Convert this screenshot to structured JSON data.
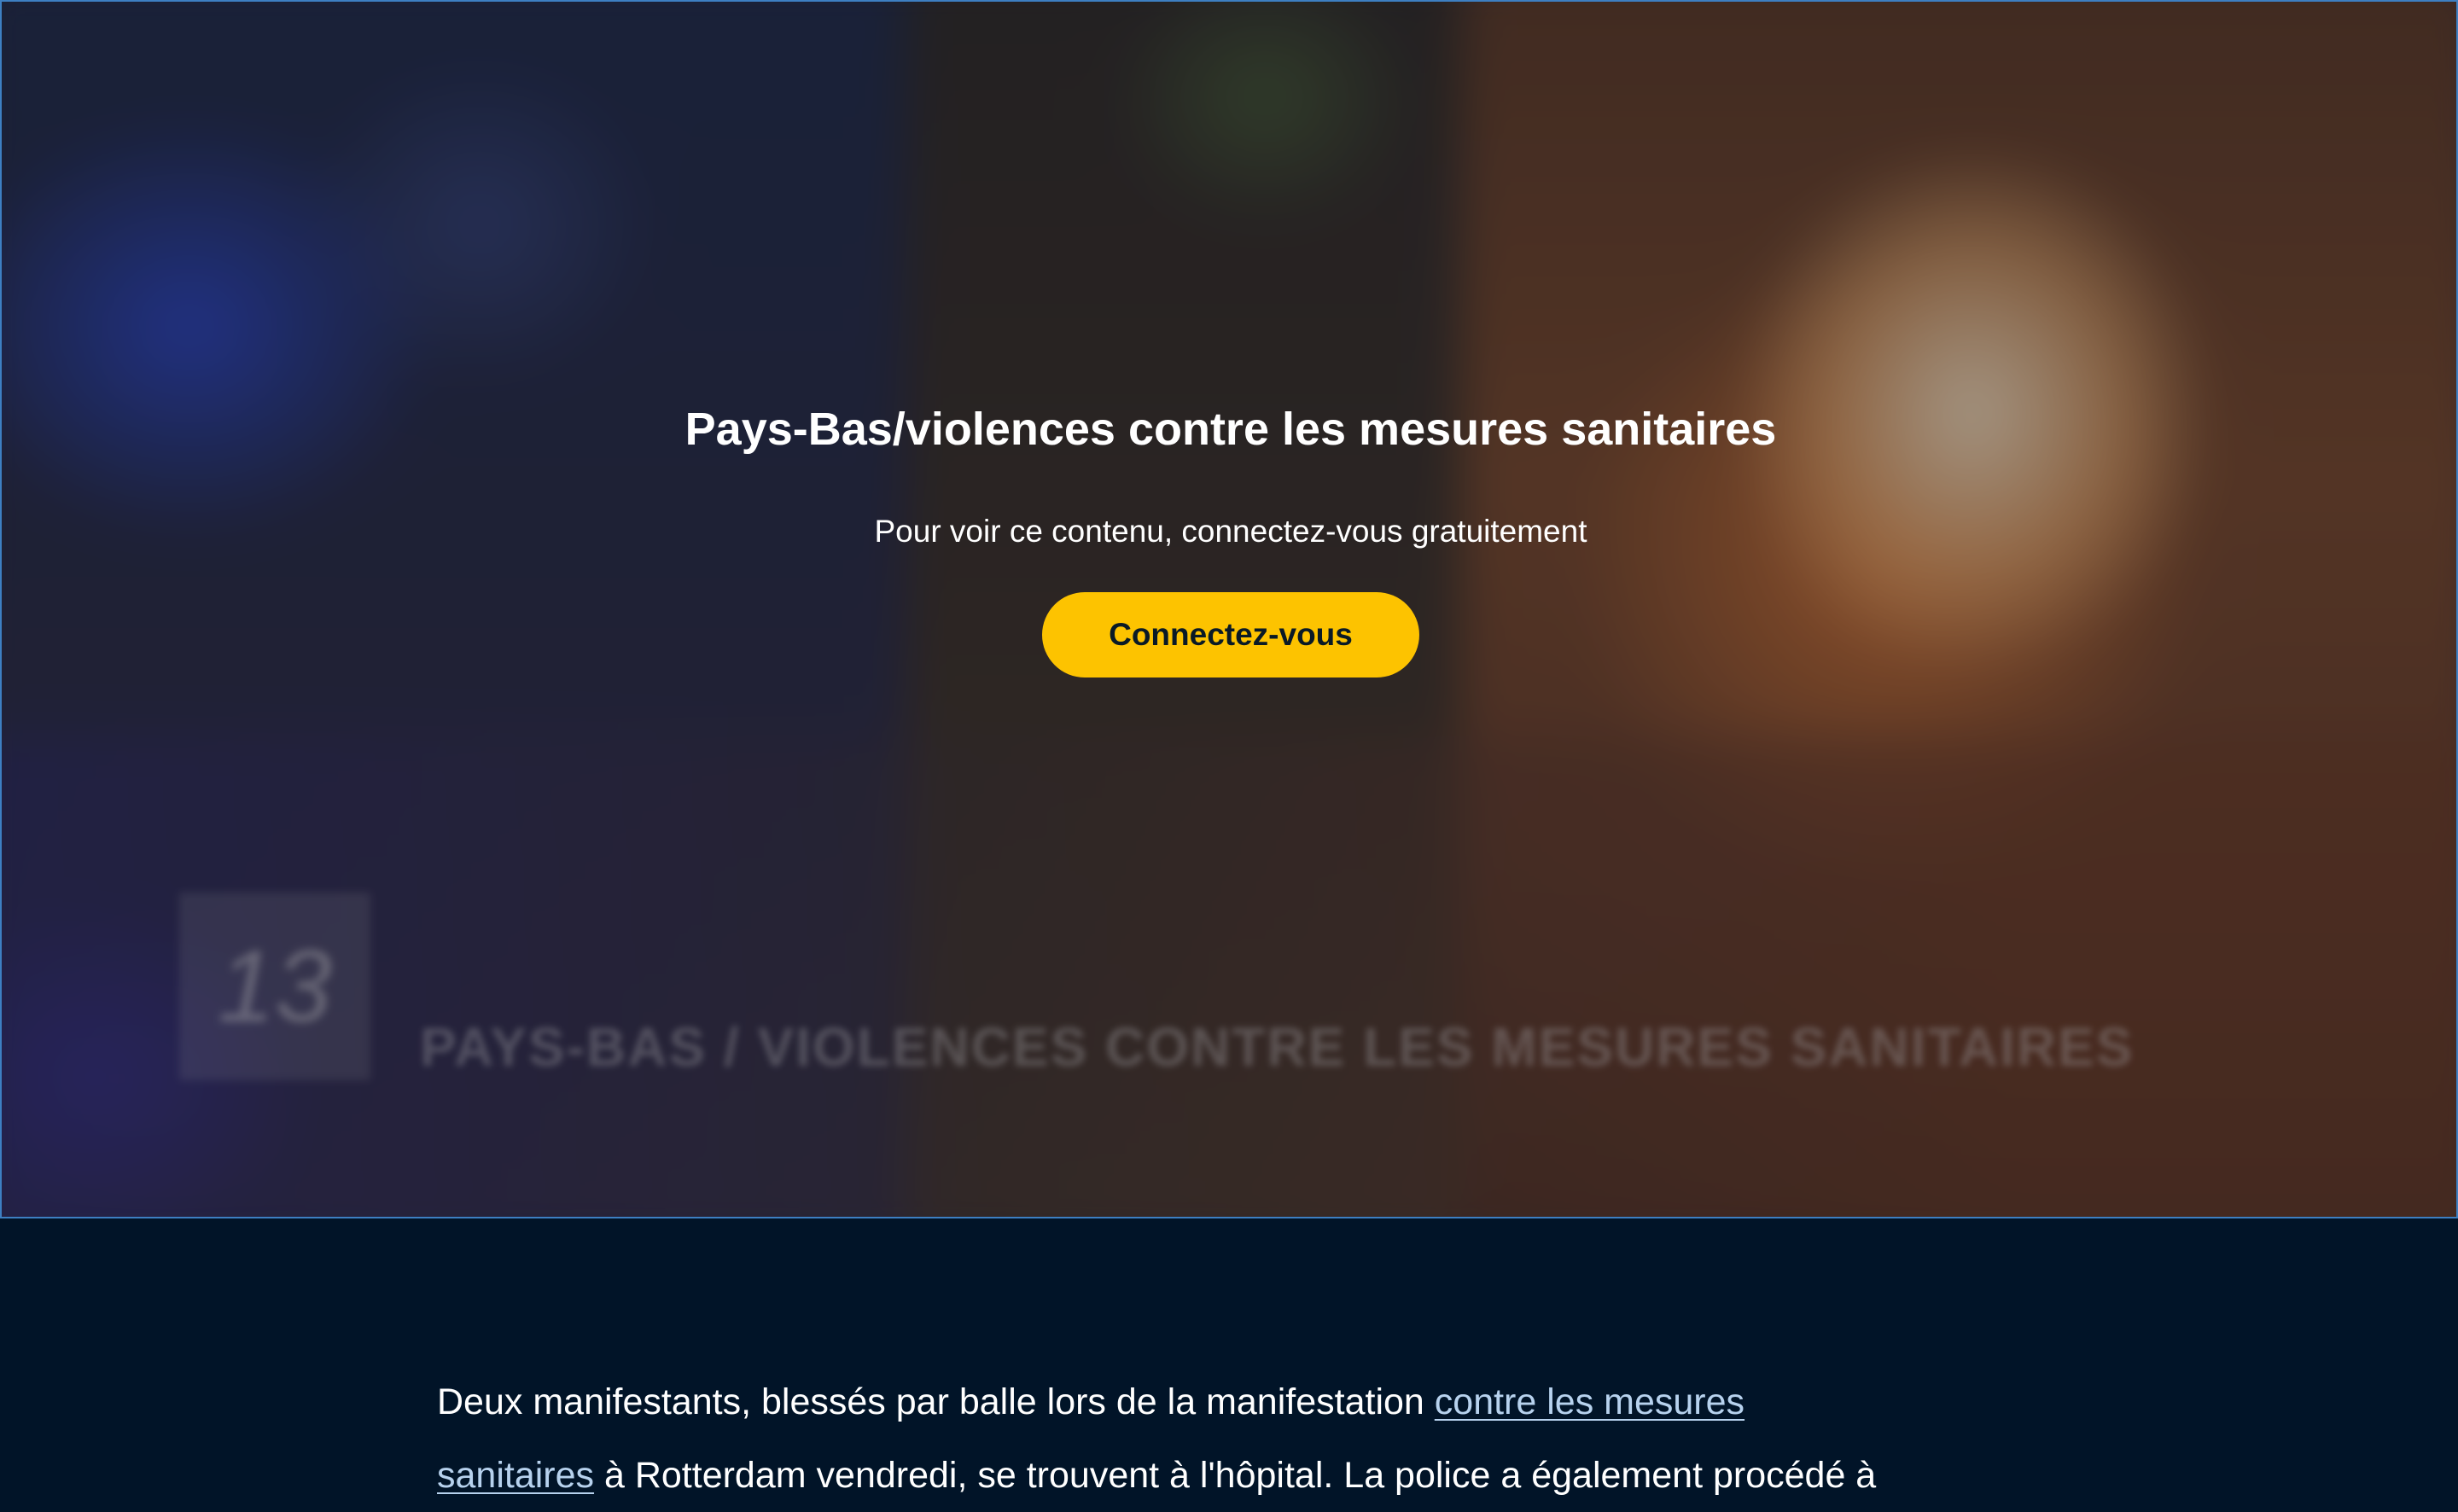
{
  "video": {
    "title": "Pays-Bas/violences contre les mesures sanitaires",
    "subtitle": "Pour voir ce contenu, connectez-vous gratuitement",
    "login_button_label": "Connectez-vous",
    "burned_caption": "PAYS-BAS / VIOLENCES CONTRE LES MESURES SANITAIRES",
    "channel_logo": "13",
    "accent_color": "#fdc300"
  },
  "article": {
    "text_before_link": "Deux manifestants, blessés par balle lors de la manifestation ",
    "link_text_part1": "contre les mesures",
    "link_text_part2": "sanitaires",
    "text_after_link": " à Rotterdam vendredi, se trouvent à l'hôpital. La police a également procédé à"
  },
  "colors": {
    "page_background": "#011428",
    "link": "#b7d2ee",
    "text": "#ffffff"
  }
}
